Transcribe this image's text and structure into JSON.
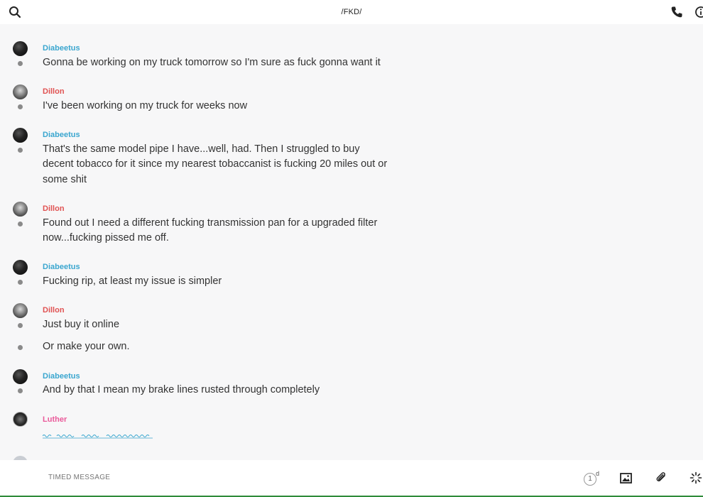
{
  "header": {
    "title": "/FKD/"
  },
  "messages": [
    {
      "author": "Diabeetus",
      "color": "#3aa6cf",
      "avatar": "dark",
      "lines": [
        "Gonna be working on my truck tomorrow so I'm sure as fuck gonna want it"
      ]
    },
    {
      "author": "Dillon",
      "color": "#e05252",
      "avatar": "dillon",
      "lines": [
        "I've been working on my truck for weeks now"
      ]
    },
    {
      "author": "Diabeetus",
      "color": "#3aa6cf",
      "avatar": "dark",
      "lines": [
        "That's the same model pipe I have...well, had. Then I struggled to buy decent tobacco for it since my nearest tobaccanist is fucking 20 miles out or some shit"
      ]
    },
    {
      "author": "Dillon",
      "color": "#e05252",
      "avatar": "dillon",
      "lines": [
        "Found out I need a different fucking transmission pan for a upgraded filter now...fucking pissed me off."
      ]
    },
    {
      "author": "Diabeetus",
      "color": "#3aa6cf",
      "avatar": "dark",
      "lines": [
        "Fucking rip, at least my issue is simpler"
      ]
    },
    {
      "author": "Dillon",
      "color": "#e05252",
      "avatar": "dillon",
      "lines": [
        "Just buy it online",
        "Or make your own."
      ]
    },
    {
      "author": "Diabeetus",
      "color": "#3aa6cf",
      "avatar": "dark",
      "lines": [
        "And by that I mean my brake lines rusted through completely"
      ]
    },
    {
      "author": "Luther",
      "color": "#ea5a9a",
      "avatar": "luther",
      "lines": []
    }
  ],
  "composer": {
    "placeholder": "TIMED MESSAGE",
    "timer_value": "1",
    "timer_unit": "d"
  },
  "icons": {
    "search": "search-icon",
    "call": "phone-icon",
    "info": "info-icon",
    "image": "image-icon",
    "attach": "paperclip-icon",
    "sparkle": "sparkle-icon"
  },
  "colors": {
    "link_blue": "#3aa6cf",
    "dillon_red": "#e05252",
    "luther_pink": "#ea5a9a",
    "typing_blue": "#3aa6cf"
  }
}
